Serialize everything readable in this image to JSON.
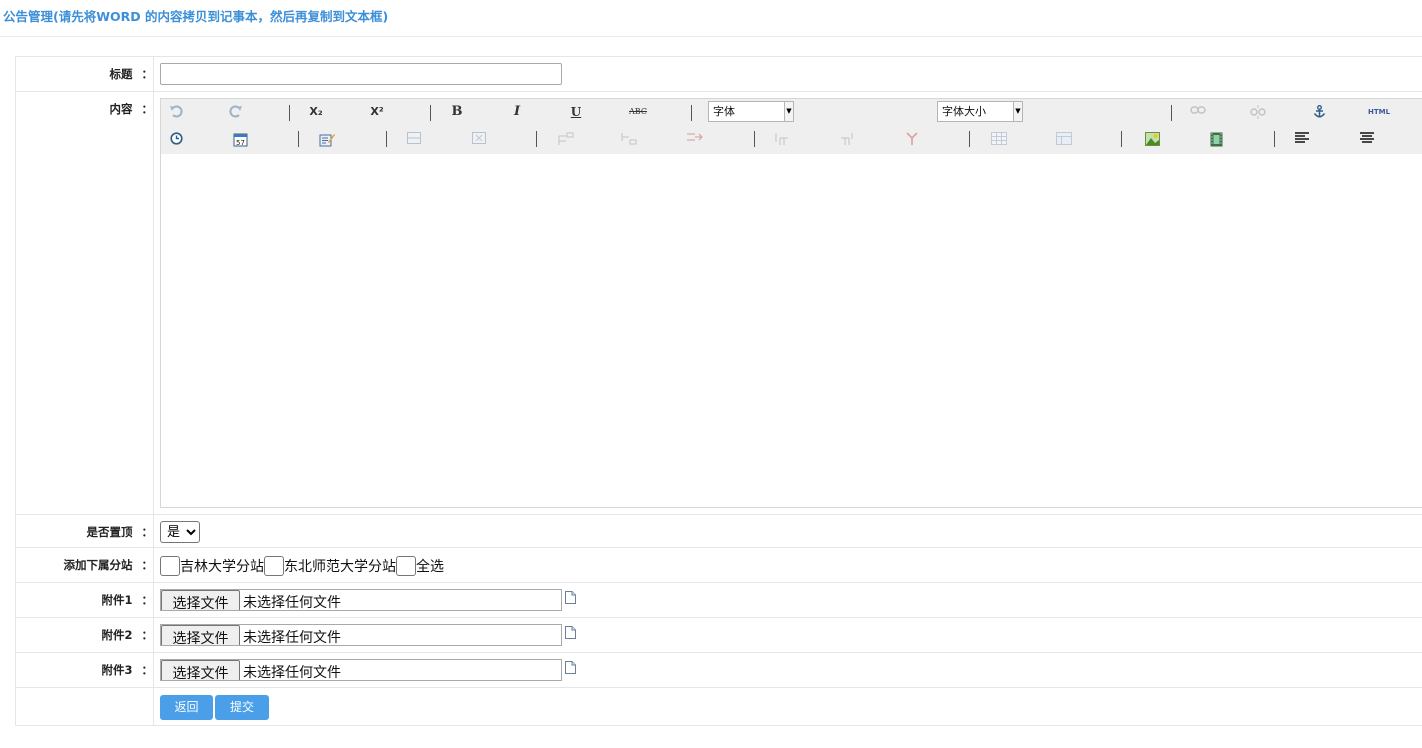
{
  "page": {
    "title": "公告管理(请先将WORD 的内容拷贝到记事本，然后再复制到文本框)"
  },
  "labels": {
    "title": "标题",
    "content": "内容",
    "pin": "是否置顶",
    "branches": "添加下属分站",
    "attach1": "附件1",
    "attach2": "附件2",
    "attach3": "附件3",
    "colon": "："
  },
  "title_input": {
    "value": "",
    "placeholder": ""
  },
  "editor": {
    "font_select": "字体",
    "size_select": "字体大小",
    "toolbar_row1": [
      "undo-icon",
      "redo-icon",
      "subscript-icon",
      "superscript-icon",
      "bold-icon",
      "italic-icon",
      "underline-icon",
      "strikethrough-icon",
      "font-select",
      "font-size-select",
      "link-icon",
      "unlink-icon",
      "anchor-icon",
      "html-icon"
    ],
    "toolbar_row2": [
      "time-icon",
      "date-icon",
      "edit-icon",
      "insert-row-icon",
      "delete-row-icon",
      "insert-column-icon",
      "delete-column-icon",
      "split-cell-icon",
      "merge-cell-icon",
      "table-icon",
      "table-props-icon",
      "image-icon",
      "media-icon",
      "align-left-icon",
      "align-center-icon"
    ],
    "glyphs": {
      "sub": "X₂",
      "sup": "X²",
      "bold": "B",
      "italic": "I",
      "underline": "U",
      "strike": "ABC",
      "html": "HTML"
    },
    "content": ""
  },
  "pin": {
    "selected": "是",
    "options": [
      "是"
    ]
  },
  "branches": [
    {
      "label": "吉林大学分站",
      "checked": false
    },
    {
      "label": "东北师范大学分站",
      "checked": false
    },
    {
      "label": "全选",
      "checked": false
    }
  ],
  "files": {
    "button_label": "选择文件",
    "status": "未选择任何文件"
  },
  "actions": {
    "back": "返回",
    "submit": "提交"
  },
  "colors": {
    "accent": "#4a9fe8",
    "title": "#3c8fd8"
  }
}
